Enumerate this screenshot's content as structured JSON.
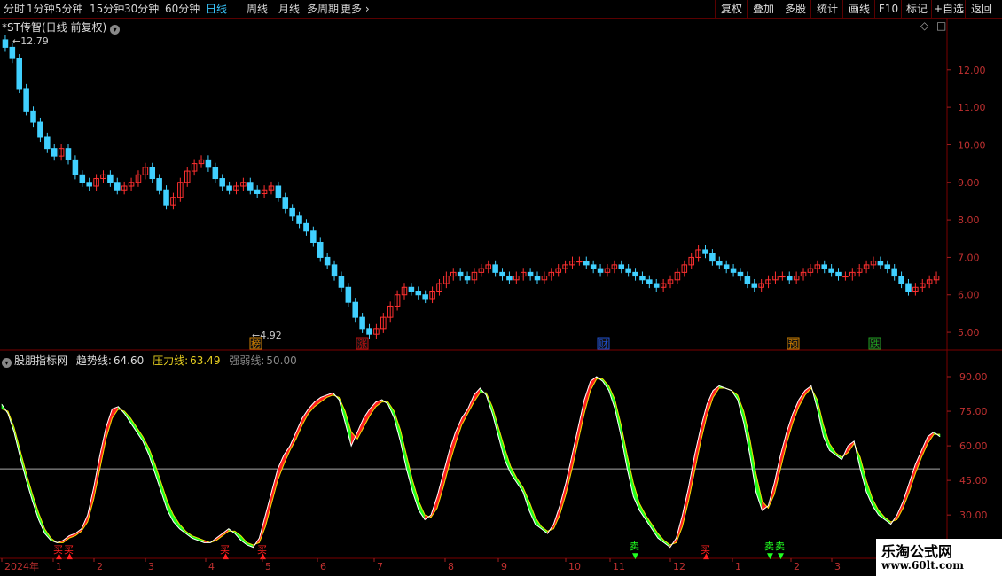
{
  "toolbar": {
    "tabs": [
      {
        "label": "分时",
        "active": false
      },
      {
        "label": "1分钟",
        "active": false
      },
      {
        "label": "5分钟",
        "active": false
      },
      {
        "label": "15分钟",
        "active": false
      },
      {
        "label": "30分钟",
        "active": false
      },
      {
        "label": "60分钟",
        "active": false
      },
      {
        "label": "日线",
        "active": true
      },
      {
        "label": "周线",
        "active": false
      },
      {
        "label": "月线",
        "active": false
      },
      {
        "label": "多周期",
        "active": false
      },
      {
        "label": "更多",
        "active": false
      }
    ],
    "right_buttons": [
      "复权",
      "叠加",
      "多股",
      "统计",
      "画线",
      "F10",
      "标记",
      "+自选",
      "返回"
    ]
  },
  "main_chart": {
    "title": "*ST传智(日线 前复权)",
    "high_label": "12.79",
    "low_label": "4.92",
    "y_ticks": [
      "12.00",
      "11.00",
      "10.00",
      "9.00",
      "8.00",
      "7.00",
      "6.00",
      "5.00"
    ],
    "events": [
      {
        "label": "榜",
        "color": "#d08000"
      },
      {
        "label": "涨",
        "color": "#c01010"
      },
      {
        "label": "财",
        "color": "#2050d0"
      },
      {
        "label": "预",
        "color": "#d08000"
      },
      {
        "label": "跌",
        "color": "#20a020"
      }
    ]
  },
  "indicator": {
    "name": "股朋指标网",
    "trend_label": "趋势线:",
    "trend_value": "64.60",
    "pressure_label": "压力线:",
    "pressure_value": "63.49",
    "strength_label": "强弱线:",
    "strength_value": "50.00",
    "y_ticks": [
      "90.00",
      "75.00",
      "60.00",
      "45.00",
      "30.00",
      "15.00"
    ],
    "signals": [
      "买",
      "买",
      "买",
      "买",
      "卖",
      "买",
      "卖",
      "卖"
    ]
  },
  "date_axis": [
    "2024年",
    "1",
    "2",
    "3",
    "4",
    "5",
    "6",
    "7",
    "8",
    "9",
    "10",
    "11",
    "12",
    "1",
    "2",
    "3"
  ],
  "watermark": {
    "title": "乐淘公式网",
    "url": "www.60lt.com"
  },
  "chart_data": [
    {
      "type": "candlestick",
      "title": "*ST传智(日线 前复权)",
      "ylim": [
        4.6,
        13.2
      ],
      "close": [
        12.6,
        12.3,
        11.5,
        10.9,
        10.6,
        10.2,
        9.9,
        9.7,
        9.9,
        9.6,
        9.2,
        9.0,
        8.9,
        9.1,
        9.2,
        9.0,
        8.8,
        8.9,
        9.0,
        9.2,
        9.4,
        9.1,
        8.8,
        8.4,
        8.6,
        9.0,
        9.3,
        9.5,
        9.6,
        9.4,
        9.1,
        8.9,
        8.8,
        8.9,
        9.0,
        8.8,
        8.7,
        8.8,
        8.9,
        8.6,
        8.3,
        8.1,
        7.9,
        7.7,
        7.4,
        7.0,
        6.8,
        6.5,
        6.2,
        5.8,
        5.4,
        5.1,
        4.95,
        5.1,
        5.4,
        5.7,
        6.0,
        6.2,
        6.1,
        6.0,
        5.9,
        6.1,
        6.3,
        6.5,
        6.6,
        6.5,
        6.4,
        6.6,
        6.7,
        6.8,
        6.6,
        6.5,
        6.4,
        6.5,
        6.6,
        6.5,
        6.4,
        6.5,
        6.6,
        6.7,
        6.8,
        6.9,
        6.9,
        6.8,
        6.7,
        6.6,
        6.7,
        6.8,
        6.7,
        6.6,
        6.5,
        6.4,
        6.3,
        6.2,
        6.3,
        6.4,
        6.6,
        6.8,
        7.0,
        7.2,
        7.1,
        6.9,
        6.8,
        6.7,
        6.6,
        6.5,
        6.3,
        6.2,
        6.3,
        6.4,
        6.5,
        6.5,
        6.4,
        6.5,
        6.6,
        6.7,
        6.8,
        6.7,
        6.6,
        6.5,
        6.5,
        6.6,
        6.7,
        6.8,
        6.9,
        6.8,
        6.7,
        6.5,
        6.3,
        6.1,
        6.2,
        6.3,
        6.4,
        6.5
      ]
    },
    {
      "type": "line",
      "series": [
        {
          "name": "趋势线",
          "values": [
            78,
            74,
            66,
            55,
            45,
            36,
            28,
            22,
            19,
            18,
            19,
            21,
            22,
            24,
            30,
            42,
            56,
            68,
            76,
            77,
            74,
            70,
            66,
            62,
            56,
            48,
            40,
            32,
            27,
            24,
            22,
            20,
            19,
            18,
            18,
            20,
            22,
            24,
            22,
            19,
            17,
            16,
            20,
            30,
            40,
            50,
            56,
            60,
            66,
            72,
            76,
            79,
            81,
            82,
            83,
            80,
            70,
            60,
            66,
            72,
            76,
            79,
            80,
            78,
            72,
            62,
            50,
            40,
            32,
            28,
            30,
            38,
            48,
            58,
            66,
            72,
            76,
            82,
            85,
            82,
            74,
            64,
            54,
            48,
            44,
            40,
            32,
            26,
            24,
            22,
            26,
            34,
            44,
            56,
            68,
            80,
            88,
            90,
            88,
            84,
            76,
            64,
            50,
            38,
            32,
            28,
            24,
            20,
            18,
            16,
            20,
            30,
            42,
            56,
            68,
            78,
            84,
            86,
            85,
            84,
            80,
            70,
            56,
            40,
            32,
            34,
            44,
            56,
            66,
            74,
            80,
            84,
            86,
            76,
            64,
            58,
            56,
            54,
            60,
            62,
            50,
            40,
            34,
            30,
            28,
            26,
            30,
            36,
            44,
            52,
            58,
            64,
            66,
            64
          ]
        },
        {
          "name": "压力线",
          "values": [
            76,
            75,
            68,
            58,
            48,
            39,
            31,
            24,
            20,
            18,
            18,
            20,
            21,
            23,
            27,
            37,
            50,
            63,
            72,
            76,
            75,
            72,
            68,
            64,
            59,
            52,
            44,
            36,
            30,
            26,
            23,
            21,
            20,
            19,
            18,
            19,
            21,
            23,
            23,
            21,
            18,
            17,
            18,
            25,
            35,
            45,
            52,
            58,
            63,
            69,
            74,
            77,
            79,
            81,
            82,
            81,
            75,
            66,
            63,
            68,
            73,
            77,
            79,
            79,
            75,
            67,
            56,
            45,
            36,
            30,
            29,
            33,
            42,
            52,
            61,
            69,
            74,
            79,
            83,
            83,
            77,
            68,
            59,
            51,
            46,
            42,
            36,
            29,
            25,
            23,
            24,
            30,
            39,
            50,
            62,
            74,
            84,
            89,
            89,
            86,
            80,
            69,
            56,
            44,
            35,
            30,
            26,
            22,
            19,
            17,
            18,
            25,
            36,
            49,
            62,
            73,
            81,
            85,
            85,
            84,
            82,
            75,
            63,
            48,
            36,
            33,
            39,
            50,
            61,
            70,
            77,
            82,
            85,
            80,
            69,
            61,
            57,
            55,
            57,
            61,
            55,
            45,
            37,
            32,
            29,
            27,
            28,
            33,
            40,
            48,
            55,
            61,
            65,
            65
          ]
        }
      ],
      "ylim": [
        12,
        95
      ]
    }
  ]
}
